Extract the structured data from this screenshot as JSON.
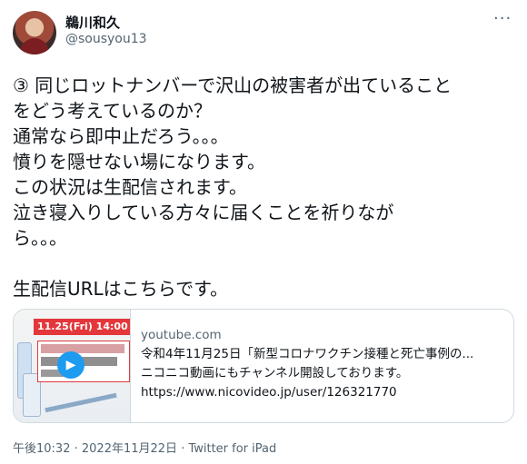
{
  "user": {
    "display_name": "鵜川和久",
    "handle": "@sousyou13"
  },
  "tweet": {
    "text": "③ 同じロットナンバーで沢山の被害者が出ていること\nをどう考えているのか？\n通常なら即中止だろう。。。\n憤りを隠せない場になります。\nこの状況は生配信されます。\n泣き寝入りしている方々に届くことを祈りなが\nら。。。\n\n生配信URLはこちらです。"
  },
  "link_card": {
    "thumb_banner": "11.25(Fri) 14:00～",
    "domain": "youtube.com",
    "title": "令和4年11月25日「新型コロナワクチン接種と死亡事例の...",
    "description": "ニコニコ動画にもチャンネル開設しております。",
    "url": "https://www.nicovideo.jp/user/126321770"
  },
  "meta": {
    "time": "午後10:32",
    "date": "2022年11月22日",
    "source": "Twitter for iPad"
  },
  "icons": {
    "more": "more-horizontal-icon",
    "play": "play-icon"
  }
}
